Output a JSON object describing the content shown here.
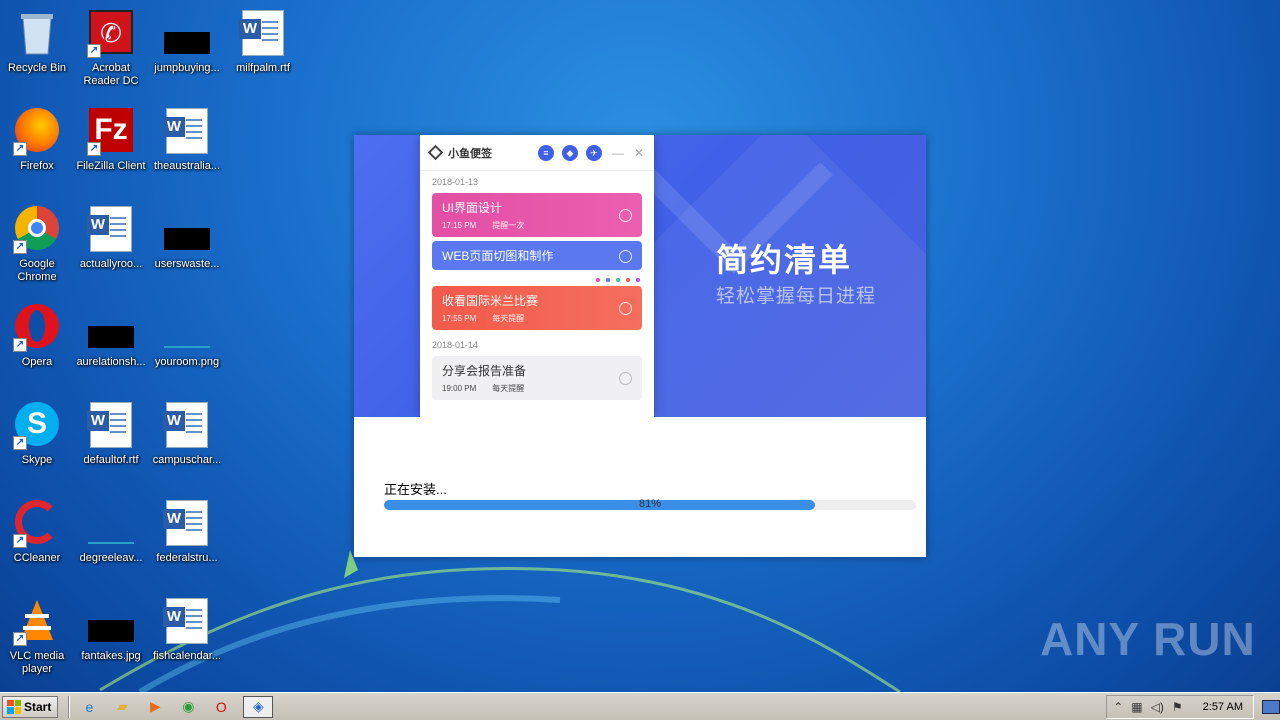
{
  "desktop": {
    "icons": [
      {
        "label": "Recycle Bin",
        "icon": "recycle-bin-icon"
      },
      {
        "label": "Acrobat Reader DC",
        "icon": "acrobat-icon"
      },
      {
        "label": "jumpbuying...",
        "icon": "black-file-icon"
      },
      {
        "label": "milfpalm.rtf",
        "icon": "word-doc-icon"
      },
      {
        "label": "Firefox",
        "icon": "firefox-icon"
      },
      {
        "label": "FileZilla Client",
        "icon": "filezilla-icon"
      },
      {
        "label": "theaustralia...",
        "icon": "word-doc-icon"
      },
      {
        "label": "Google Chrome",
        "icon": "chrome-icon"
      },
      {
        "label": "actuallyroo...",
        "icon": "word-doc-icon"
      },
      {
        "label": "userswaste...",
        "icon": "black-file-icon"
      },
      {
        "label": "Opera",
        "icon": "opera-icon"
      },
      {
        "label": "aurelationsh...",
        "icon": "black-file-icon"
      },
      {
        "label": "youroom.png",
        "icon": "image-file-icon"
      },
      {
        "label": "Skype",
        "icon": "skype-icon"
      },
      {
        "label": "defaultof.rtf",
        "icon": "word-doc-icon"
      },
      {
        "label": "campuschar...",
        "icon": "word-doc-icon"
      },
      {
        "label": "CCleaner",
        "icon": "ccleaner-icon"
      },
      {
        "label": "degreeleav...",
        "icon": "image-file-icon"
      },
      {
        "label": "federalstru...",
        "icon": "word-doc-icon"
      },
      {
        "label": "VLC media player",
        "icon": "vlc-icon"
      },
      {
        "label": "fantakes.jpg",
        "icon": "black-file-icon"
      },
      {
        "label": "fishcalendar...",
        "icon": "word-doc-icon"
      }
    ]
  },
  "installer": {
    "hero_title": "简约清单",
    "hero_subtitle": "轻松掌握每日进程",
    "mock_app": {
      "logo_text": "小鱼便签",
      "groups": [
        {
          "date": "2018-01-13",
          "cards": [
            {
              "title": "UI界面设计",
              "time": "17:15 PM",
              "repeat": "提醒一次",
              "color": "pink"
            },
            {
              "title": "WEB页面切图和制作",
              "time": "",
              "repeat": "",
              "color": "blue"
            },
            {
              "title": "收看国际米兰比赛",
              "time": "17:55 PM",
              "repeat": "每天提醒",
              "color": "red"
            }
          ]
        },
        {
          "date": "2018-01-14",
          "cards": [
            {
              "title": "分享会报告准备",
              "time": "19:00 PM",
              "repeat": "每天提醒",
              "color": "gray"
            }
          ]
        }
      ],
      "color_dots": [
        "#e24fa4",
        "#5b78f0",
        "#3dbf8a",
        "#f25a4a",
        "#b04fe2"
      ]
    },
    "status_text": "正在安装...",
    "progress": 0.81,
    "progress_text": "81%"
  },
  "watermark": "ANY RUN",
  "taskbar": {
    "start_label": "Start",
    "pinned": [
      {
        "icon": "ie-icon",
        "glyph": "e",
        "color": "#1e7ad4"
      },
      {
        "icon": "folder-icon",
        "glyph": "▰",
        "color": "#e0b040"
      },
      {
        "icon": "media-player-icon",
        "glyph": "▶",
        "color": "#e07020"
      },
      {
        "icon": "chrome-icon",
        "glyph": "◉",
        "color": "#2a9d3a"
      },
      {
        "icon": "opera-icon",
        "glyph": "O",
        "color": "#d01010"
      },
      {
        "icon": "installer-app-icon",
        "glyph": "◈",
        "color": "#2a6ad0"
      }
    ],
    "clock": "2:57 AM"
  }
}
